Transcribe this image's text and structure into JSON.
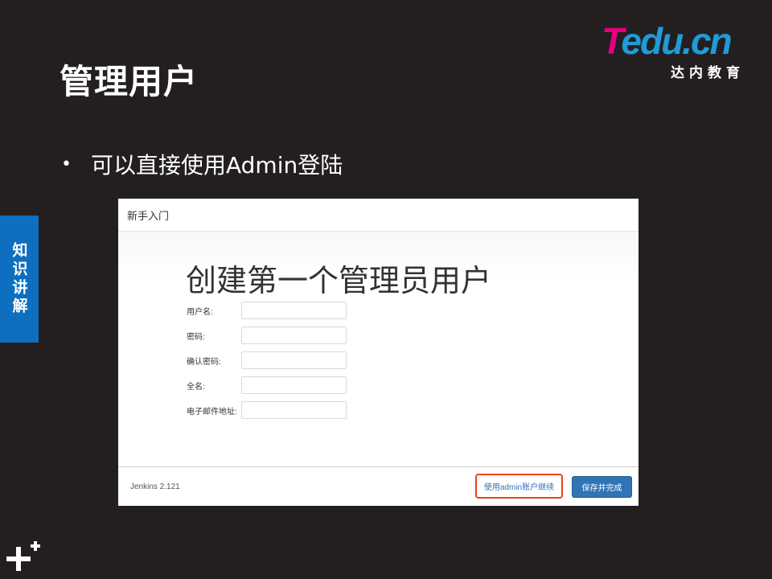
{
  "slide": {
    "title": "管理用户",
    "bullet": "可以直接使用Admin登陆",
    "side_tab": "知识讲解"
  },
  "logo": {
    "main_t": "T",
    "main_rest": "edu.cn",
    "sub": "达内教育"
  },
  "jenkins": {
    "header": "新手入门",
    "heading": "创建第一个管理员用户",
    "fields": [
      {
        "label": "用户名:",
        "value": ""
      },
      {
        "label": "密码:",
        "value": ""
      },
      {
        "label": "确认密码:",
        "value": ""
      },
      {
        "label": "全名:",
        "value": ""
      },
      {
        "label": "电子邮件地址:",
        "value": ""
      }
    ],
    "version": "Jenkins 2.121",
    "admin_button": "使用admin账户继续",
    "save_button": "保存并完成"
  },
  "colors": {
    "background": "#231f20",
    "side_tab": "#0e6fc0",
    "logo_pink": "#e6007e",
    "logo_blue": "#1f9bd7",
    "highlight": "#e8431f",
    "primary_button": "#2f74b5"
  },
  "icons": {
    "corner": "plus-sparkle-icon"
  }
}
